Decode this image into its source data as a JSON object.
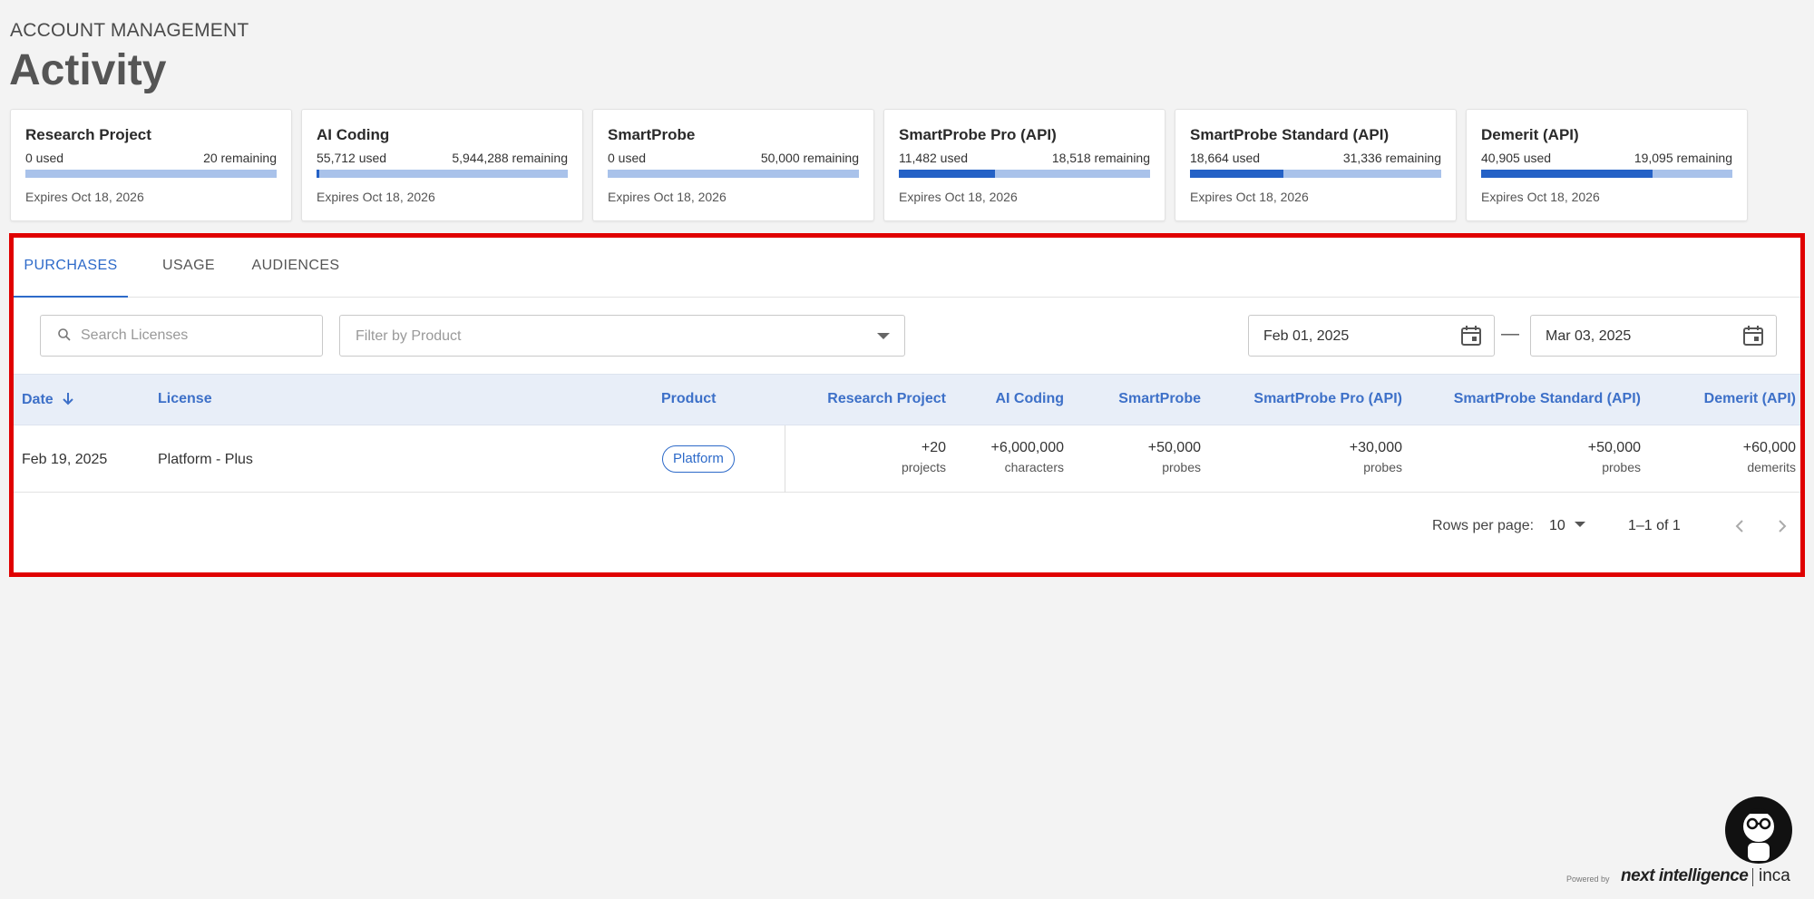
{
  "header": {
    "eyebrow": "ACCOUNT MANAGEMENT",
    "title": "Activity"
  },
  "cards": [
    {
      "title": "Research Project",
      "used": "0 used",
      "remaining": "20 remaining",
      "used_fraction": 0.0,
      "expires": "Expires Oct 18, 2026"
    },
    {
      "title": "AI Coding",
      "used": "55,712 used",
      "remaining": "5,944,288 remaining",
      "used_fraction": 0.0093,
      "expires": "Expires Oct 18, 2026"
    },
    {
      "title": "SmartProbe",
      "used": "0 used",
      "remaining": "50,000 remaining",
      "used_fraction": 0.0,
      "expires": "Expires Oct 18, 2026"
    },
    {
      "title": "SmartProbe Pro (API)",
      "used": "11,482 used",
      "remaining": "18,518 remaining",
      "used_fraction": 0.3827,
      "expires": "Expires Oct 18, 2026"
    },
    {
      "title": "SmartProbe Standard (API)",
      "used": "18,664 used",
      "remaining": "31,336 remaining",
      "used_fraction": 0.3733,
      "expires": "Expires Oct 18, 2026"
    },
    {
      "title": "Demerit (API)",
      "used": "40,905 used",
      "remaining": "19,095 remaining",
      "used_fraction": 0.6818,
      "expires": "Expires Oct 18, 2026"
    }
  ],
  "tabs": [
    {
      "label": "PURCHASES",
      "active": true
    },
    {
      "label": "USAGE",
      "active": false
    },
    {
      "label": "AUDIENCES",
      "active": false
    }
  ],
  "filters": {
    "search_placeholder": "Search Licenses",
    "product_placeholder": "Filter by Product",
    "date_from": "Feb 01, 2025",
    "date_to": "Mar 03, 2025",
    "date_separator": "—"
  },
  "table": {
    "columns": [
      "Date",
      "License",
      "Product",
      "Research Project",
      "AI Coding",
      "SmartProbe",
      "SmartProbe Pro (API)",
      "SmartProbe Standard (API)",
      "Demerit (API)"
    ],
    "rows": [
      {
        "date": "Feb 19, 2025",
        "license": "Platform - Plus",
        "product": "Platform",
        "research_project": {
          "value": "+20",
          "unit": "projects"
        },
        "ai_coding": {
          "value": "+6,000,000",
          "unit": "characters"
        },
        "smartprobe": {
          "value": "+50,000",
          "unit": "probes"
        },
        "smartprobe_pro": {
          "value": "+30,000",
          "unit": "probes"
        },
        "smartprobe_standard": {
          "value": "+50,000",
          "unit": "probes"
        },
        "demerit": {
          "value": "+60,000",
          "unit": "demerits"
        }
      }
    ]
  },
  "pagination": {
    "rows_per_page_label": "Rows per page:",
    "rows_per_page": "10",
    "range": "1–1 of 1"
  },
  "footer": {
    "powered_by": "Powered by",
    "brand": "next intelligence",
    "brand2": "inca"
  },
  "colors": {
    "accent": "#2d6ac9",
    "bar_fill": "#2461c6",
    "bar_track": "#a9c2ea",
    "highlight_border": "#e00000"
  }
}
